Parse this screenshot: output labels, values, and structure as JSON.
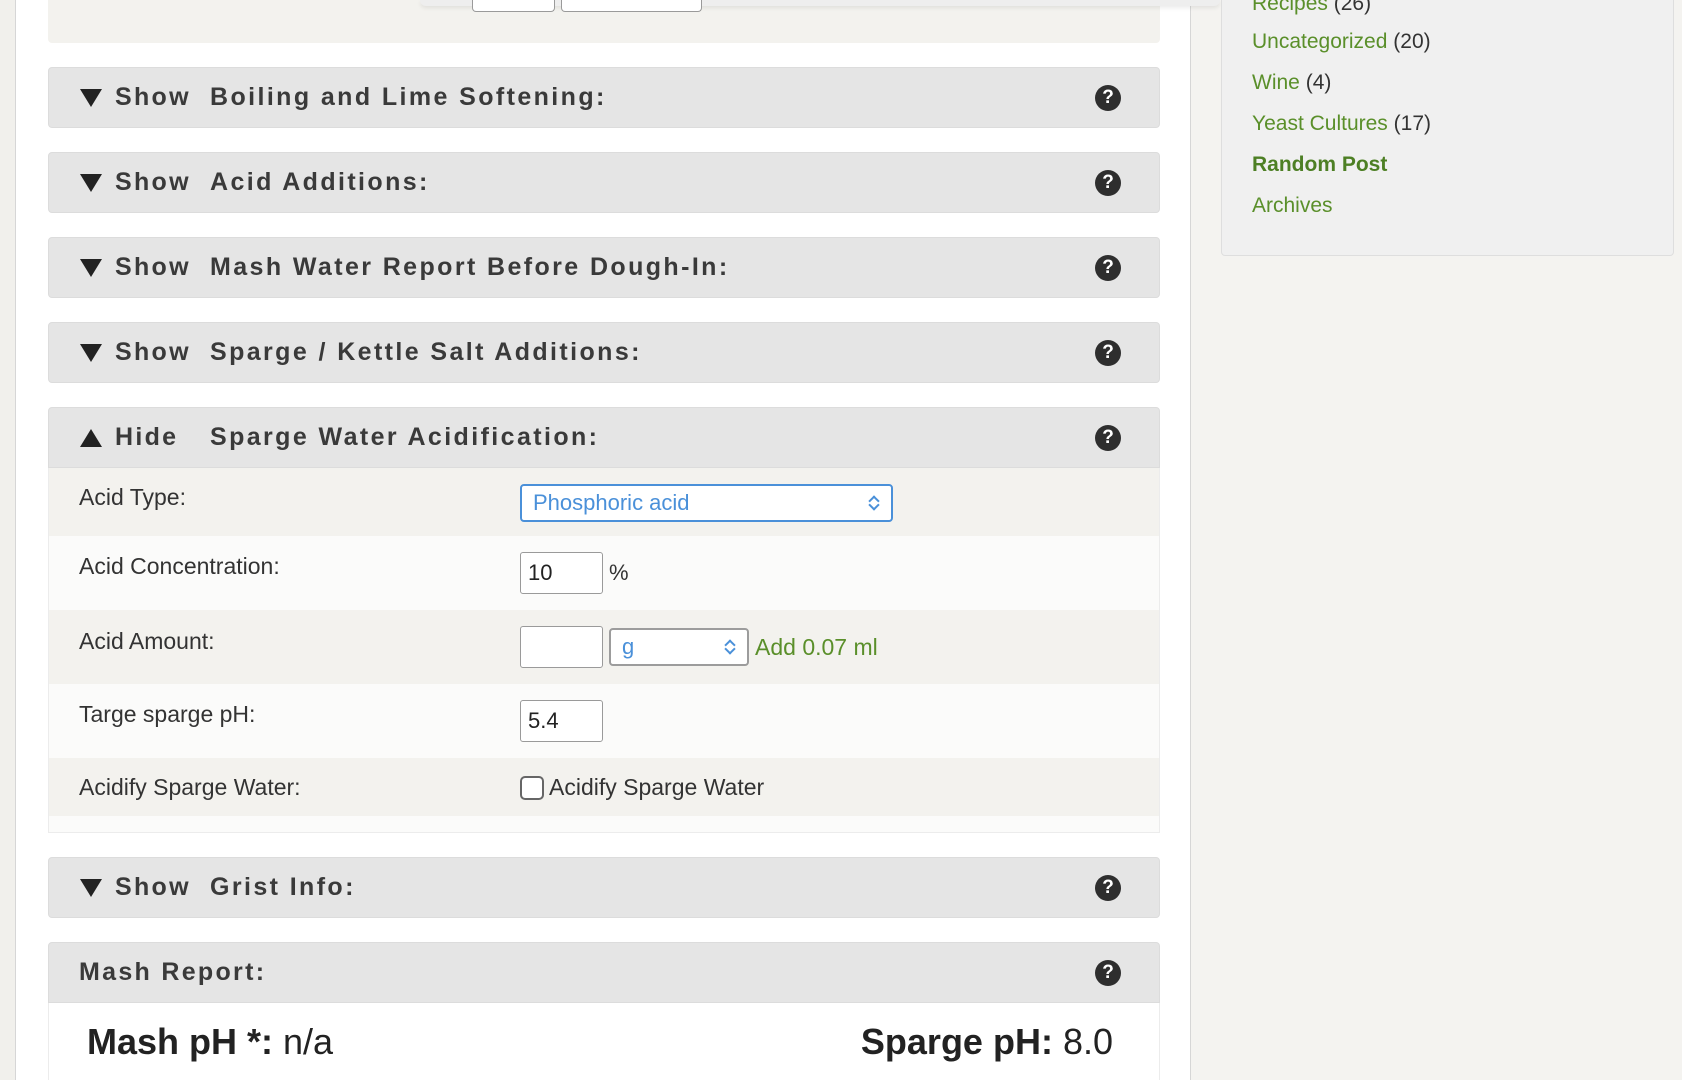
{
  "sections": [
    {
      "toggle": "Show",
      "title": "Boiling and Lime Softening:"
    },
    {
      "toggle": "Show",
      "title": "Acid Additions:"
    },
    {
      "toggle": "Show",
      "title": "Mash Water Report Before Dough-In:"
    },
    {
      "toggle": "Show",
      "title": "Sparge / Kettle Salt Additions:"
    },
    {
      "toggle": "Hide",
      "title": "Sparge Water Acidification:"
    },
    {
      "toggle": "Show",
      "title": "Grist Info:"
    }
  ],
  "help_glyph": "?",
  "acidification": {
    "acid_type_label": "Acid Type:",
    "acid_type_value": "Phosphoric acid",
    "concentration_label": "Acid Concentration:",
    "concentration_value": "10",
    "concentration_unit": "%",
    "amount_label": "Acid Amount:",
    "amount_value": "",
    "amount_unit": "g",
    "amount_result": "Add 0.07 ml",
    "target_ph_label": "Targe sparge pH:",
    "target_ph_value": "5.4",
    "acidify_label": "Acidify Sparge Water:",
    "acidify_checkbox_label": "Acidify Sparge Water",
    "acidify_checked": false
  },
  "mash_report": {
    "title": "Mash Report:",
    "mash_ph_label": "Mash pH *:",
    "mash_ph_value": "n/a",
    "sparge_ph_label": "Sparge pH:",
    "sparge_ph_value": "8.0"
  },
  "sidebar": {
    "categories": [
      {
        "name": "Recipes",
        "count": "(26)"
      },
      {
        "name": "Uncategorized",
        "count": "(20)"
      },
      {
        "name": "Wine",
        "count": "(4)"
      },
      {
        "name": "Yeast Cultures",
        "count": "(17)"
      }
    ],
    "random_post": "Random Post",
    "archives": "Archives"
  },
  "colors": {
    "link_green": "#5a8f2a",
    "select_blue": "#4a90d9",
    "header_gray": "#e5e5e5"
  }
}
